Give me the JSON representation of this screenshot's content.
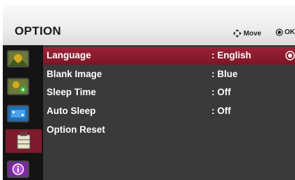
{
  "header": {
    "title": "OPTION",
    "move_hint": "Move",
    "ok_hint": "OK"
  },
  "sidebar": {
    "categories": [
      {
        "name": "picture",
        "icon": "picture-icon"
      },
      {
        "name": "audio",
        "icon": "picture-audio-icon"
      },
      {
        "name": "screen",
        "icon": "screen-icon"
      },
      {
        "name": "option",
        "icon": "toolbox-icon",
        "selected": true
      },
      {
        "name": "information",
        "icon": "info-icon"
      }
    ]
  },
  "menu": {
    "items": [
      {
        "label": "Language",
        "value": ": English",
        "selected": true
      },
      {
        "label": "Blank Image",
        "value": ": Blue"
      },
      {
        "label": "Sleep Time",
        "value": ": Off"
      },
      {
        "label": "Auto Sleep",
        "value": ": Off"
      },
      {
        "label": "Option Reset",
        "value": ""
      }
    ]
  },
  "colors": {
    "selection": "#8b1c2f",
    "panel": "#3a3a3a",
    "sidebar": "#141414",
    "header": "#efefef"
  }
}
